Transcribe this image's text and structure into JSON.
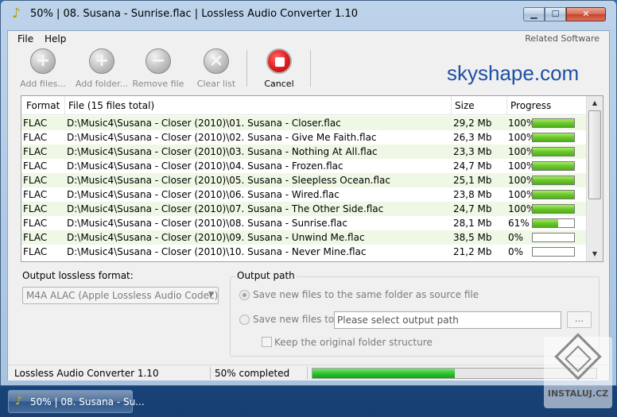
{
  "window": {
    "title": "50% | 08. Susana - Sunrise.flac | Lossless Audio Converter 1.10",
    "title_icon": "music-note-icon",
    "controls": {
      "minimize": "▁",
      "maximize": "☐",
      "close": "✕"
    }
  },
  "menu": {
    "items": [
      "File",
      "Help"
    ],
    "related": "Related Software"
  },
  "toolbar": {
    "buttons": [
      {
        "label": "Add files...",
        "icon": "add-icon",
        "enabled": false
      },
      {
        "label": "Add folder...",
        "icon": "add-icon",
        "enabled": false
      },
      {
        "label": "Remove file",
        "icon": "remove-icon",
        "enabled": false
      },
      {
        "label": "Clear list",
        "icon": "clear-icon",
        "enabled": false
      },
      {
        "label": "Cancel",
        "icon": "stop-icon",
        "enabled": true
      }
    ],
    "glyphs": {
      "add": "+",
      "remove": "−",
      "clear": "×"
    },
    "brand": "skyshape.com"
  },
  "file_list": {
    "columns": [
      "Format",
      "File (15 files total)",
      "Size",
      "Progress"
    ],
    "rows": [
      {
        "format": "FLAC",
        "file": "D:\\Music4\\Susana - Closer (2010)\\01. Susana - Closer.flac",
        "size": "29,2 Mb",
        "progress_text": "100%",
        "progress": 1.0
      },
      {
        "format": "FLAC",
        "file": "D:\\Music4\\Susana - Closer (2010)\\02. Susana - Give Me Faith.flac",
        "size": "26,3 Mb",
        "progress_text": "100%",
        "progress": 1.0
      },
      {
        "format": "FLAC",
        "file": "D:\\Music4\\Susana - Closer (2010)\\03. Susana - Nothing At All.flac",
        "size": "23,3 Mb",
        "progress_text": "100%",
        "progress": 1.0
      },
      {
        "format": "FLAC",
        "file": "D:\\Music4\\Susana - Closer (2010)\\04. Susana - Frozen.flac",
        "size": "24,7 Mb",
        "progress_text": "100%",
        "progress": 1.0
      },
      {
        "format": "FLAC",
        "file": "D:\\Music4\\Susana - Closer (2010)\\05. Susana - Sleepless Ocean.flac",
        "size": "25,1 Mb",
        "progress_text": "100%",
        "progress": 1.0
      },
      {
        "format": "FLAC",
        "file": "D:\\Music4\\Susana - Closer (2010)\\06. Susana - Wired.flac",
        "size": "23,8 Mb",
        "progress_text": "100%",
        "progress": 1.0
      },
      {
        "format": "FLAC",
        "file": "D:\\Music4\\Susana - Closer (2010)\\07. Susana - The Other Side.flac",
        "size": "24,7 Mb",
        "progress_text": "100%",
        "progress": 1.0
      },
      {
        "format": "FLAC",
        "file": "D:\\Music4\\Susana - Closer (2010)\\08. Susana - Sunrise.flac",
        "size": "28,1 Mb",
        "progress_text": "61%",
        "progress": 0.61
      },
      {
        "format": "FLAC",
        "file": "D:\\Music4\\Susana - Closer (2010)\\09. Susana - Unwind Me.flac",
        "size": "38,5 Mb",
        "progress_text": "0%",
        "progress": 0
      },
      {
        "format": "FLAC",
        "file": "D:\\Music4\\Susana - Closer (2010)\\10. Susana - Never Mine.flac",
        "size": "21,2 Mb",
        "progress_text": "0%",
        "progress": 0
      }
    ],
    "scroll_up": "▲",
    "scroll_down": "▼"
  },
  "output_format": {
    "label": "Output lossless format:",
    "selected": "M4A ALAC (Apple Lossless Audio Codec)",
    "arrow": "▼"
  },
  "output_path": {
    "title": "Output path",
    "option_same": "Save new files to the same folder as source file",
    "option_custom": "Save new files to:",
    "path_placeholder": "Please select output path",
    "browse_label": "...",
    "keep_structure": "Keep the original folder structure",
    "selected_option": "same"
  },
  "status_bar": {
    "app": "Lossless Audio Converter 1.10",
    "status": "50% completed",
    "progress": 0.5
  },
  "taskbar": {
    "task_label": "50% | 08. Susana - Su...",
    "task_icon": "music-note-icon"
  },
  "watermark": {
    "text": "INSTALUJ.CZ"
  },
  "colors": {
    "brand": "#1f4fa6",
    "progress_green": "#6cc72a",
    "cancel_red": "#e01b1b",
    "row_alt": "#eef8e4"
  }
}
